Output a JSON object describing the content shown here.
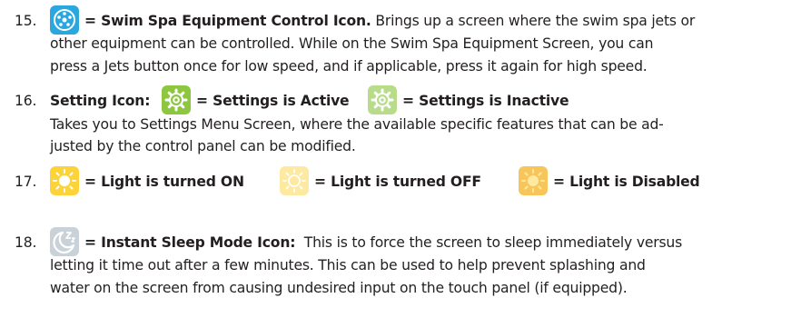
{
  "items": [
    {
      "number": "15.",
      "icon": "swim-spa-jets-icon",
      "title": "= Swim Spa Equipment Control Icon.",
      "lines": [
        "Brings up a screen where the swim spa jets or",
        "other equipment can be controlled. While on the Swim Spa Equipment Screen, you can",
        "press a Jets button once for low speed, and if applicable, press it again for high speed."
      ]
    },
    {
      "number": "16.",
      "label": "Setting Icon:",
      "states": [
        {
          "icon": "settings-active-icon",
          "text": "= Settings is Active"
        },
        {
          "icon": "settings-inactive-icon",
          "text": "= Settings is Inactive"
        }
      ],
      "lines": [
        "Takes you to Settings Menu Screen, where the available specific features that can be ad-",
        "justed by the control panel can be modified."
      ]
    },
    {
      "number": "17.",
      "states": [
        {
          "icon": "light-on-icon",
          "text": "= Light is turned ON"
        },
        {
          "icon": "light-off-icon",
          "text": "= Light is turned OFF"
        },
        {
          "icon": "light-disabled-icon",
          "text": "= Light is Disabled"
        }
      ]
    },
    {
      "number": "18.",
      "icon": "sleep-mode-icon",
      "title": "= Instant Sleep Mode Icon:",
      "lines": [
        "This is to force the screen to sleep immediately versus",
        "letting it time out after a few minutes. This can be used to help prevent splashing and",
        "water on the screen from causing undesired input on the touch panel (if equipped)."
      ]
    }
  ],
  "colors": {
    "text": "#231f20",
    "jets_blue": "#2aa7df",
    "settings_green": "#8dc63f",
    "settings_inactive": "#b8dc8a",
    "light_yellow": "#fdd33a",
    "light_off": "#fde9a0",
    "sleep_grey": "#c9d2d8"
  }
}
